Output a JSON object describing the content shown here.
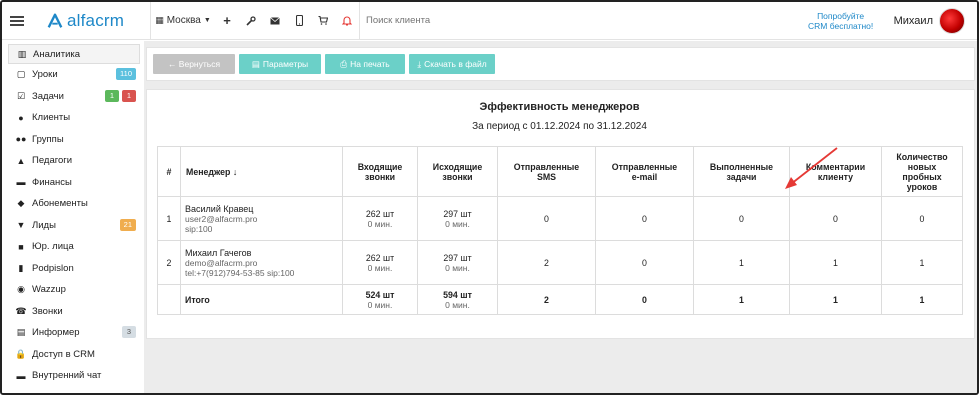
{
  "topbar": {
    "logo_text": "alfacrm",
    "branch": "Москва",
    "search_placeholder": "Поиск клиента",
    "promo_line1": "Попробуйте",
    "promo_line2": "CRM бесплатно!",
    "user_name": "Михаил"
  },
  "sidebar": {
    "items": [
      {
        "label": "Аналитика",
        "icon": "chart-icon",
        "glyph": "▥"
      },
      {
        "label": "Уроки",
        "icon": "calendar-icon",
        "glyph": "▢",
        "badges": [
          {
            "text": "110",
            "color": "#5bc0de"
          }
        ]
      },
      {
        "label": "Задачи",
        "icon": "tasks-icon",
        "glyph": "☑",
        "badges": [
          {
            "text": "1",
            "color": "#5cb85c"
          },
          {
            "text": "1",
            "color": "#d9534f"
          }
        ]
      },
      {
        "label": "Клиенты",
        "icon": "user-icon",
        "glyph": "●"
      },
      {
        "label": "Группы",
        "icon": "users-icon",
        "glyph": "●●"
      },
      {
        "label": "Педагоги",
        "icon": "graduation-cap-icon",
        "glyph": "▲"
      },
      {
        "label": "Финансы",
        "icon": "money-icon",
        "glyph": "▬"
      },
      {
        "label": "Абонементы",
        "icon": "tag-icon",
        "glyph": "◆"
      },
      {
        "label": "Лиды",
        "icon": "funnel-icon",
        "glyph": "▼",
        "badges": [
          {
            "text": "21",
            "color": "#f0ad4e"
          }
        ]
      },
      {
        "label": "Юр. лица",
        "icon": "briefcase-icon",
        "glyph": "■"
      },
      {
        "label": "Podpislon",
        "icon": "document-icon",
        "glyph": "▮"
      },
      {
        "label": "Wazzup",
        "icon": "whatsapp-icon",
        "glyph": "◉"
      },
      {
        "label": "Звонки",
        "icon": "phone-icon",
        "glyph": "☎"
      },
      {
        "label": "Информер",
        "icon": "list-icon",
        "glyph": "▤",
        "badges": [
          {
            "text": "3",
            "color": "#d5dde3"
          }
        ]
      },
      {
        "label": "Доступ в CRM",
        "icon": "lock-icon",
        "glyph": "🔒"
      },
      {
        "label": "Внутренний чат",
        "icon": "chat-icon",
        "glyph": "▬"
      }
    ]
  },
  "toolbar": {
    "back_label": "← Вернуться",
    "params_label": "Параметры",
    "print_label": "На печать",
    "download_label": "Скачать в файл"
  },
  "report": {
    "title": "Эффективность менеджеров",
    "subtitle": "За период с 01.12.2024 по 31.12.2024",
    "columns": {
      "num": "#",
      "manager": "Менеджер",
      "manager_sort": "↓",
      "incoming": [
        "Входящие",
        "звонки"
      ],
      "outgoing": [
        "Исходящие",
        "звонки"
      ],
      "sms": [
        "Отправленные",
        "SMS"
      ],
      "email": [
        "Отправленные",
        "e-mail"
      ],
      "tasks": [
        "Выполненные",
        "задачи"
      ],
      "comments": [
        "Комментарии",
        "клиенту"
      ],
      "trials": [
        "Количество",
        "новых",
        "пробных",
        "уроков"
      ]
    },
    "rows": [
      {
        "num": "1",
        "name": "Василий Кравец",
        "line2": "user2@alfacrm.pro",
        "line3": "sip:100",
        "incoming_count": "262 шт",
        "incoming_time": "0 мин.",
        "outgoing_count": "297 шт",
        "outgoing_time": "0 мин.",
        "sms": "0",
        "email": "0",
        "tasks": "0",
        "comments": "0",
        "trials": "0"
      },
      {
        "num": "2",
        "name": "Михаил Гачегов",
        "line2": "demo@alfacrm.pro",
        "line3": "tel:+7(912)794-53-85  sip:100",
        "incoming_count": "262 шт",
        "incoming_time": "0 мин.",
        "outgoing_count": "297 шт",
        "outgoing_time": "0 мин.",
        "sms": "2",
        "email": "0",
        "tasks": "1",
        "comments": "1",
        "trials": "1"
      }
    ],
    "total": {
      "label": "Итого",
      "incoming_count": "524 шт",
      "incoming_time": "0 мин.",
      "outgoing_count": "594 шт",
      "outgoing_time": "0 мин.",
      "sms": "2",
      "email": "0",
      "tasks": "1",
      "comments": "1",
      "trials": "1"
    }
  },
  "colors": {
    "accent": "#1e88c8",
    "button_teal": "#6bd0c8",
    "button_gray": "#c3c3c3",
    "annotation_arrow": "#e53935"
  }
}
